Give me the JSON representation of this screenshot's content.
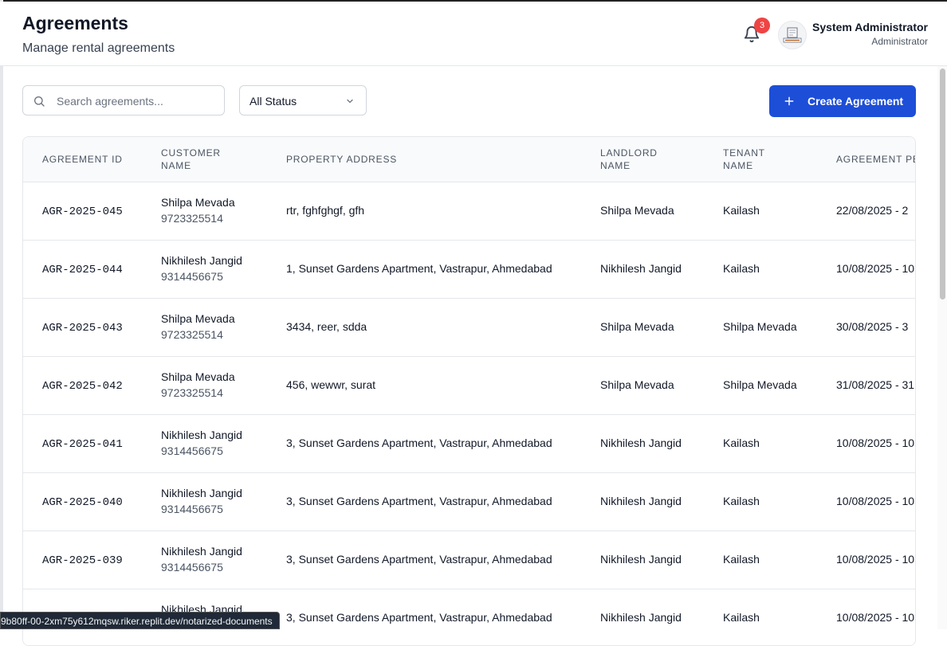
{
  "header": {
    "title": "Agreements",
    "subtitle": "Manage rental agreements",
    "notification_count": "3",
    "user_name": "System Administrator",
    "user_role": "Administrator"
  },
  "toolbar": {
    "search_placeholder": "Search agreements...",
    "status_filter": "All Status",
    "create_label": "Create Agreement"
  },
  "table": {
    "headers": {
      "id": "AGREEMENT ID",
      "customer_1": "CUSTOMER",
      "customer_2": "NAME",
      "address": "PROPERTY ADDRESS",
      "landlord_1": "LANDLORD",
      "landlord_2": "NAME",
      "tenant_1": "TENANT",
      "tenant_2": "NAME",
      "period": "AGREEMENT PE"
    },
    "rows": [
      {
        "id": "AGR-2025-045",
        "customer": "Shilpa Mevada",
        "phone": "9723325514",
        "address": "rtr, fghfghgf, gfh",
        "landlord": "Shilpa Mevada",
        "tenant": "Kailash",
        "period": "22/08/2025 - 2"
      },
      {
        "id": "AGR-2025-044",
        "customer": "Nikhilesh Jangid",
        "phone": "9314456675",
        "address": "1, Sunset Gardens Apartment, Vastrapur, Ahmedabad",
        "landlord": "Nikhilesh Jangid",
        "tenant": "Kailash",
        "period": "10/08/2025 - 10"
      },
      {
        "id": "AGR-2025-043",
        "customer": "Shilpa Mevada",
        "phone": "9723325514",
        "address": "3434, reer, sdda",
        "landlord": "Shilpa Mevada",
        "tenant": "Shilpa Mevada",
        "period": "30/08/2025 - 3"
      },
      {
        "id": "AGR-2025-042",
        "customer": "Shilpa Mevada",
        "phone": "9723325514",
        "address": "456, wewwr, surat",
        "landlord": "Shilpa Mevada",
        "tenant": "Shilpa Mevada",
        "period": "31/08/2025 - 31"
      },
      {
        "id": "AGR-2025-041",
        "customer": "Nikhilesh Jangid",
        "phone": "9314456675",
        "address": "3, Sunset Gardens Apartment, Vastrapur, Ahmedabad",
        "landlord": "Nikhilesh Jangid",
        "tenant": "Kailash",
        "period": "10/08/2025 - 10"
      },
      {
        "id": "AGR-2025-040",
        "customer": "Nikhilesh Jangid",
        "phone": "9314456675",
        "address": "3, Sunset Gardens Apartment, Vastrapur, Ahmedabad",
        "landlord": "Nikhilesh Jangid",
        "tenant": "Kailash",
        "period": "10/08/2025 - 10"
      },
      {
        "id": "AGR-2025-039",
        "customer": "Nikhilesh Jangid",
        "phone": "9314456675",
        "address": "3, Sunset Gardens Apartment, Vastrapur, Ahmedabad",
        "landlord": "Nikhilesh Jangid",
        "tenant": "Kailash",
        "period": "10/08/2025 - 10"
      },
      {
        "id": "",
        "customer": "Nikhilesh Jangid",
        "phone": "",
        "address": "3, Sunset Gardens Apartment, Vastrapur, Ahmedabad",
        "landlord": "Nikhilesh Jangid",
        "tenant": "Kailash",
        "period": "10/08/2025 - 10"
      }
    ]
  },
  "status_bar": {
    "url": "9b80ff-00-2xm75y612mqsw.riker.replit.dev/notarized-documents"
  },
  "colors": {
    "primary": "#1d4ed8",
    "badge": "#ef4444"
  },
  "icons": [
    "bell-icon",
    "search-icon",
    "chevron-down-icon",
    "plus-icon"
  ]
}
